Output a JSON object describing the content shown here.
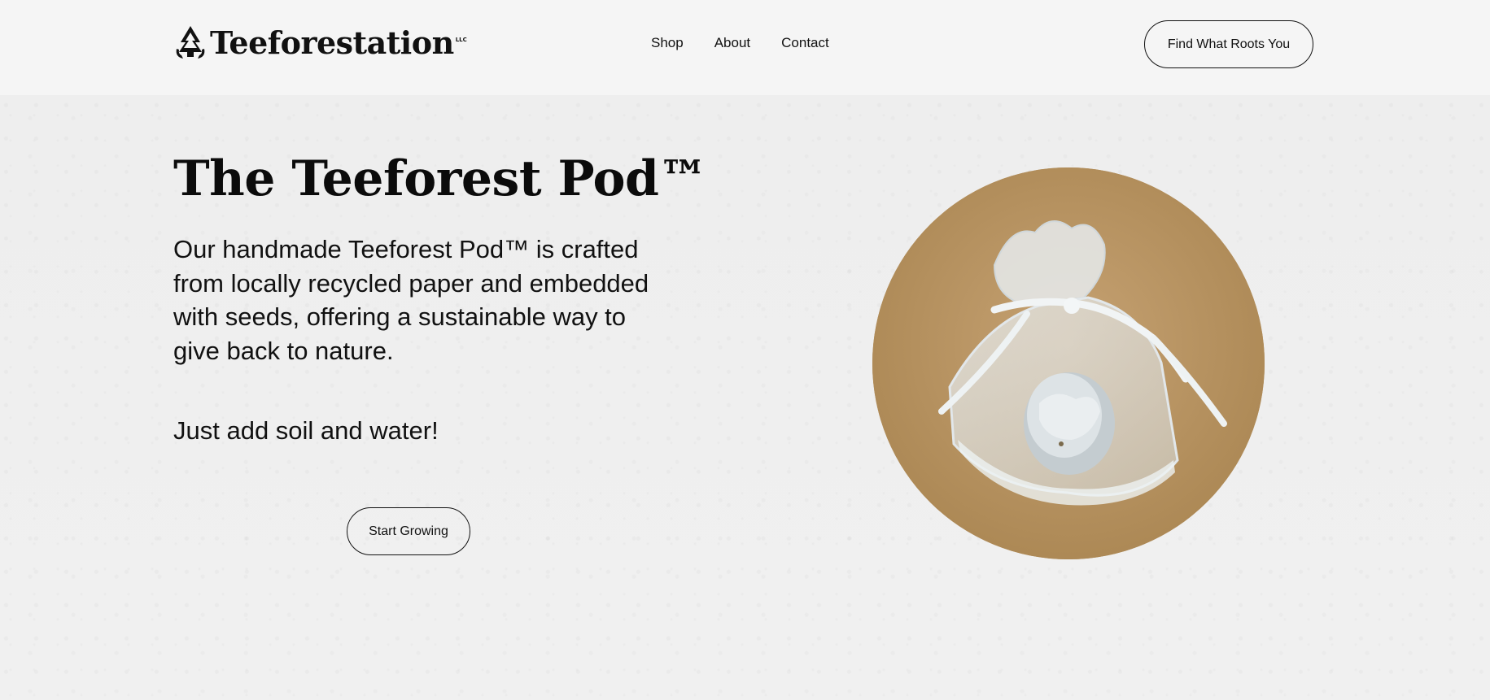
{
  "brand": {
    "name": "Teeforestation",
    "suffix": "LLC"
  },
  "nav": {
    "items": [
      "Shop",
      "About",
      "Contact"
    ],
    "cta_label": "Find What Roots You"
  },
  "hero": {
    "title": "The Teeforest Pod™",
    "description": "Our handmade Teeforest Pod™ is crafted from locally recycled paper and embedded with seeds, offering a sustainable way to give back to nature.",
    "subtitle": "Just add soil and water!",
    "cta_label": "Start Growing"
  },
  "colors": {
    "header_bg": "#f5f5f5",
    "page_bg": "#efefef",
    "text": "#111111",
    "kraft": "#b8935f"
  },
  "icons": {
    "logo": "recycle-tree-icon"
  }
}
